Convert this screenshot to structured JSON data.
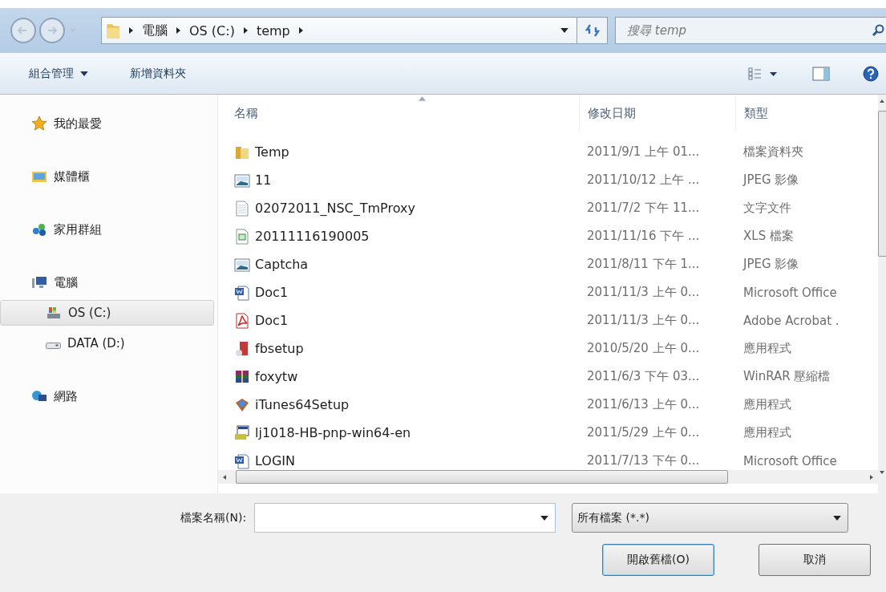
{
  "address_bar": {
    "crumbs": [
      "電腦",
      "OS (C:)",
      "temp"
    ]
  },
  "search": {
    "placeholder": "搜尋 temp"
  },
  "toolbar": {
    "buttons": [
      "組合管理",
      "新增資料夾"
    ]
  },
  "sidebar": {
    "items": [
      {
        "label": "我的最愛",
        "kind": "favorites",
        "selected": false
      },
      {
        "label": "媒體櫃",
        "kind": "libraries",
        "selected": false
      },
      {
        "label": "家用群組",
        "kind": "homegroup",
        "selected": false
      },
      {
        "label": "電腦",
        "kind": "computer",
        "selected": false,
        "children": [
          {
            "label": "OS (C:)",
            "kind": "system-drive",
            "selected": true
          },
          {
            "label": "DATA (D:)",
            "kind": "drive",
            "selected": false
          }
        ]
      },
      {
        "label": "網路",
        "kind": "network",
        "selected": false
      }
    ]
  },
  "table": {
    "columns": [
      "名稱",
      "修改日期",
      "類型"
    ],
    "rows": [
      {
        "name": "Temp",
        "date": "2011/9/1 上午 01...",
        "type": "檔案資料夾",
        "kind": "folder"
      },
      {
        "name": "11",
        "date": "2011/10/12 上午 ...",
        "type": "JPEG 影像",
        "kind": "image"
      },
      {
        "name": "02072011_NSC_TmProxy",
        "date": "2011/7/2 下午 11...",
        "type": "文字文件",
        "kind": "text"
      },
      {
        "name": "20111116190005",
        "date": "2011/11/16 下午 ...",
        "type": "XLS 檔案",
        "kind": "sheet"
      },
      {
        "name": "Captcha",
        "date": "2011/8/11 下午 1...",
        "type": "JPEG 影像",
        "kind": "image"
      },
      {
        "name": "Doc1",
        "date": "2011/11/3 上午 0...",
        "type": "Microsoft Office",
        "kind": "word"
      },
      {
        "name": "Doc1",
        "date": "2011/11/3 上午 0...",
        "type": "Adobe Acrobat .",
        "kind": "pdf"
      },
      {
        "name": "fbsetup",
        "date": "2010/5/20 上午 0...",
        "type": "應用程式",
        "kind": "setup"
      },
      {
        "name": "foxytw",
        "date": "2011/6/3 下午 03...",
        "type": "WinRAR 壓縮檔",
        "kind": "archive"
      },
      {
        "name": "iTunes64Setup",
        "date": "2011/6/13 上午 0...",
        "type": "應用程式",
        "kind": "box"
      },
      {
        "name": "lj1018-HB-pnp-win64-en",
        "date": "2011/5/29 上午 0...",
        "type": "應用程式",
        "kind": "installer"
      },
      {
        "name": "LOGIN",
        "date": "2011/7/13 下午 0...",
        "type": "Microsoft Office",
        "kind": "word"
      }
    ]
  },
  "footer": {
    "filename_label": "檔案名稱(N):",
    "filter": "所有檔案 (*.*)",
    "buttons": [
      "開啟舊檔(O)",
      "取消"
    ]
  }
}
